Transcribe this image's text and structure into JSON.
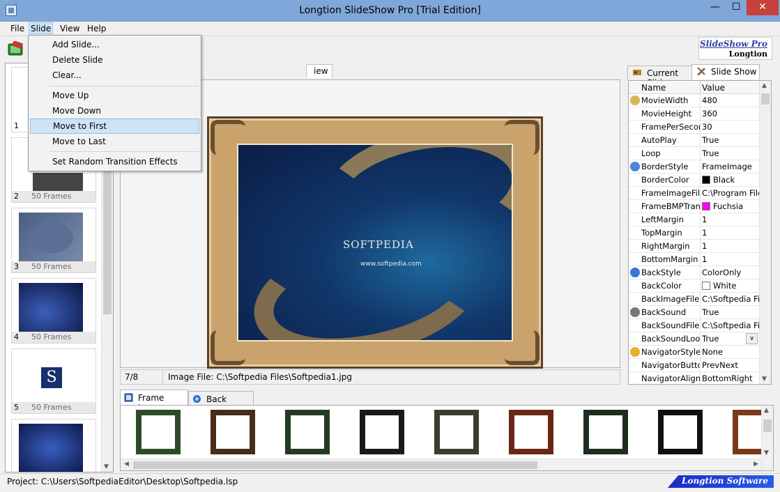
{
  "window": {
    "title": "Longtion SlideShow Pro [Trial Edition]",
    "minimize": "—",
    "maximize": "☐",
    "close": "✕"
  },
  "menu": [
    "File",
    "Slide",
    "View",
    "Help"
  ],
  "slide_menu": {
    "items": [
      "Add Slide...",
      "Delete Slide",
      "Clear...",
      "Move Up",
      "Move Down",
      "Move to First",
      "Move to Last",
      "Set Random Transition Effects"
    ],
    "highlighted": "Move to First"
  },
  "logo": {
    "line1": "SlideShow Pro",
    "line2": "Longtion"
  },
  "slides": [
    {
      "number": "1",
      "frames": ""
    },
    {
      "number": "2",
      "frames": "50 Frames"
    },
    {
      "number": "3",
      "frames": "50 Frames"
    },
    {
      "number": "4",
      "frames": "50 Frames"
    },
    {
      "number": "5",
      "frames": "50 Frames"
    },
    {
      "number": "",
      "frames": ""
    }
  ],
  "center": {
    "tab_label": "iew",
    "position": "7/8",
    "image_file": "Image File: C:\\Softpedia Files\\Softpedia1.jpg",
    "watermark": "SOFTPEDIA",
    "watermark_url": "www.softpedia.com"
  },
  "right_tabs": [
    "Current Slide",
    "Slide Show"
  ],
  "props": {
    "col_name": "Name",
    "col_value": "Value",
    "rows": [
      {
        "name": "MovieWidth",
        "value": "480"
      },
      {
        "name": "MovieHeight",
        "value": "360"
      },
      {
        "name": "FramePerSecond",
        "value": "30"
      },
      {
        "name": "AutoPlay",
        "value": "True"
      },
      {
        "name": "Loop",
        "value": "True"
      },
      {
        "name": "BorderStyle",
        "value": "FrameImage"
      },
      {
        "name": "BorderColor",
        "value": "Black",
        "swatch": "#000000"
      },
      {
        "name": "FrameImageFile",
        "value": "C:\\Program Files"
      },
      {
        "name": "FrameBMPTransp",
        "value": "Fuchsia",
        "swatch": "#ff00ff"
      },
      {
        "name": "LeftMargin",
        "value": "1"
      },
      {
        "name": "TopMargin",
        "value": "1"
      },
      {
        "name": "RightMargin",
        "value": "1"
      },
      {
        "name": "BottomMargin",
        "value": "1"
      },
      {
        "name": "BackStyle",
        "value": "ColorOnly"
      },
      {
        "name": "BackColor",
        "value": "White",
        "swatch": "#ffffff"
      },
      {
        "name": "BackImageFile",
        "value": "C:\\Softpedia File"
      },
      {
        "name": "BackSound",
        "value": "True"
      },
      {
        "name": "BackSoundFile",
        "value": "C:\\Softpedia File"
      },
      {
        "name": "BackSoundLoop",
        "value": "True"
      },
      {
        "name": "NavigatorStyle",
        "value": "None"
      },
      {
        "name": "NavigatorButtons",
        "value": "PrevNext"
      },
      {
        "name": "NavigatorAlign",
        "value": "BottomRight"
      }
    ]
  },
  "bottom_tabs": [
    "Frame Images",
    "Back Images"
  ],
  "status": {
    "project": "Project: C:\\Users\\SoftpediaEditor\\Desktop\\Softpedia.lsp",
    "brand": "Longtion Software"
  },
  "colors": {
    "titlebar": "#7fa7d9",
    "menu_highlight": "#cfe3f6",
    "brand_blue": "#1a28c8",
    "close_red": "#c7403a"
  }
}
